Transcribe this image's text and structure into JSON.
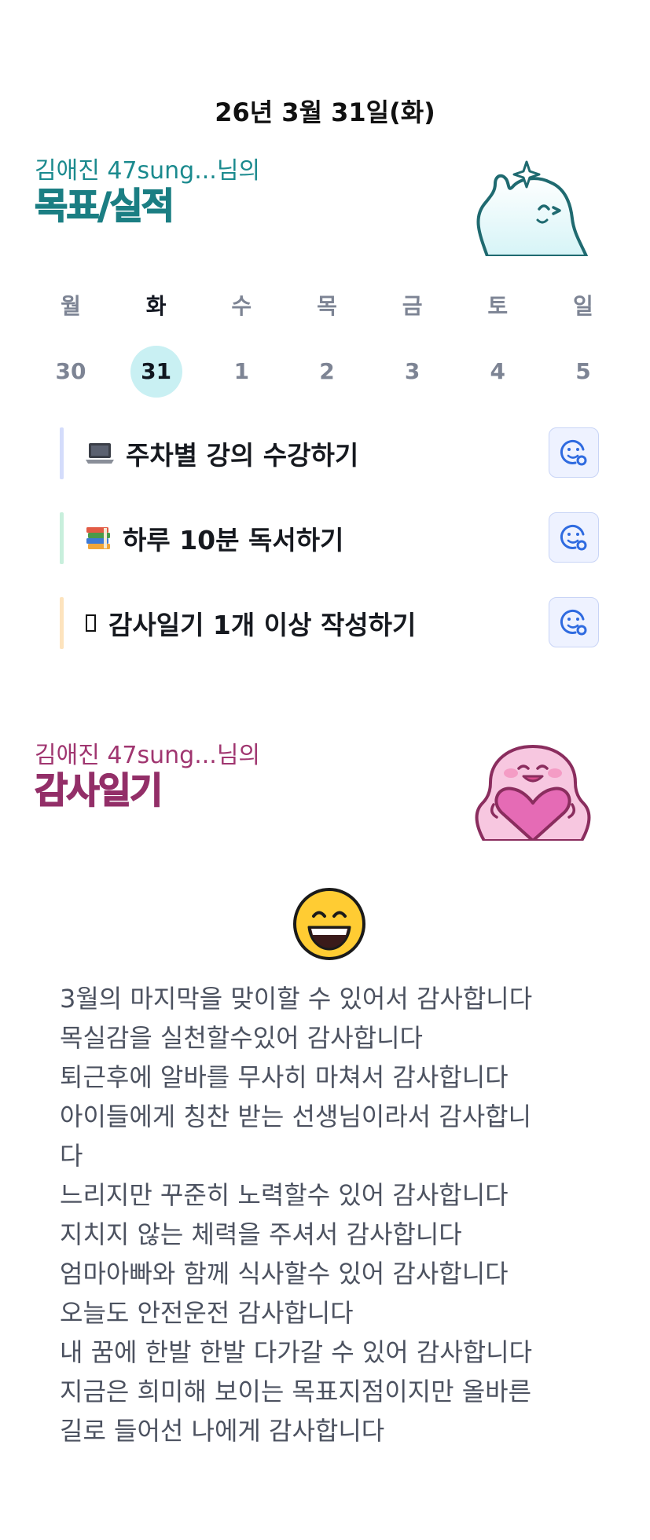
{
  "header": {
    "date": "26년 3월 31일(화)"
  },
  "goals_section": {
    "owner": "김애진 47sung...님의",
    "title": "목표/실적",
    "mascot_icon": "sparkle-blob-mascot-icon"
  },
  "week": {
    "day_names": [
      "월",
      "화",
      "수",
      "목",
      "금",
      "토",
      "일"
    ],
    "dates": [
      "30",
      "31",
      "1",
      "2",
      "3",
      "4",
      "5"
    ],
    "active_day_index": 1,
    "selected_color": "#c9f0f3"
  },
  "goals": [
    {
      "emoji": "💻",
      "emoji_icon": "laptop-icon",
      "label": "주차별 강의 수강하기",
      "bar_color": "#d4dcfb",
      "action_icon": "smiley-add-icon"
    },
    {
      "emoji": "📚",
      "emoji_icon": "books-icon",
      "label": "하루 10분 독서하기",
      "bar_color": "#c8efdc",
      "action_icon": "smiley-add-icon"
    },
    {
      "emoji": "▯",
      "emoji_icon": "missing-glyph-icon",
      "label": "감사일기 1개 이상 작성하기",
      "bar_color": "#fde3bd",
      "action_icon": "smiley-add-icon"
    }
  ],
  "gratitude_section": {
    "owner": "김애진 47sung...님의",
    "title": "감사일기",
    "mascot_icon": "heart-hug-mascot-icon",
    "mood_icon": "grinning-face-icon",
    "text": "3월의 마지막을 맞이할 수 있어서 감사합니다\n목실감을 실천할수있어 감사합니다\n퇴근후에 알바를 무사히 마쳐서 감사합니다\n아이들에게 칭찬 받는 선생님이라서 감사합니\n다\n느리지만 꾸준히 노력할수 있어 감사합니다\n지치지 않는 체력을 주셔서 감사합니다\n엄마아빠와 함께 식사할수 있어 감사합니다\n오늘도 안전운전 감사합니다\n내 꿈에 한발 한발 다가갈 수 있어 감사합니다\n지금은 희미해 보이는 목표지점이지만 올바른\n길로 들어선 나에게 감사합니다"
  },
  "colors": {
    "goals_accent": "#1b7e83",
    "gratitude_accent": "#932f68",
    "action_icon": "#2f6be0"
  }
}
